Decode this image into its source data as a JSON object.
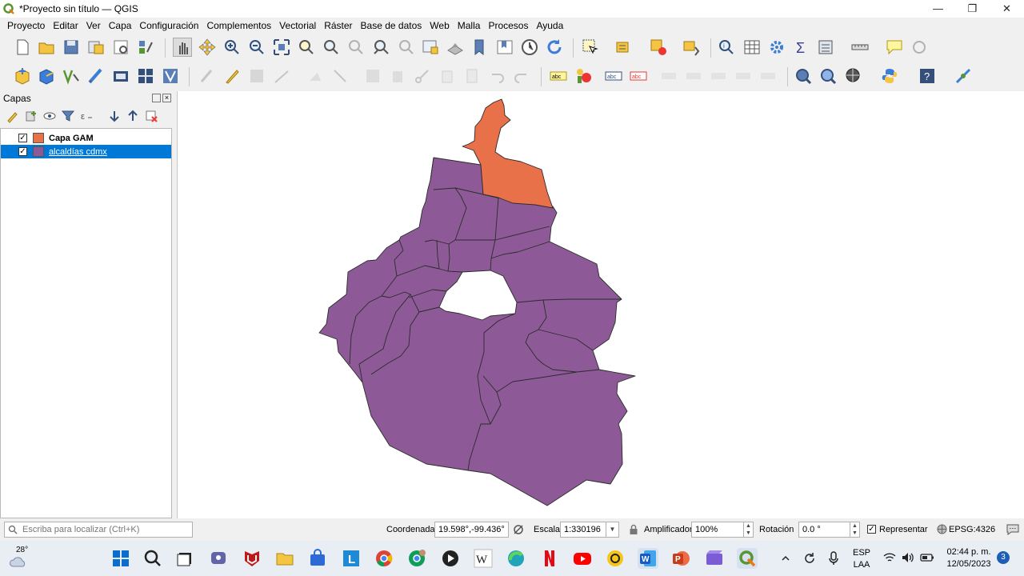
{
  "window": {
    "title": "*Proyecto sin título — QGIS",
    "minimize": "—",
    "maximize": "❐",
    "close": "✕"
  },
  "menu": [
    "Proyecto",
    "Editar",
    "Ver",
    "Capa",
    "Configuración",
    "Complementos",
    "Vectorial",
    "Ráster",
    "Base de datos",
    "Web",
    "Malla",
    "Procesos",
    "Ayuda"
  ],
  "layers_panel": {
    "title": "Capas",
    "layers": [
      {
        "name": "Capa GAM",
        "checked": "✓",
        "color": "#e8714a",
        "selected": false
      },
      {
        "name": "alcaldías cdmx",
        "checked": "✓",
        "color": "#8d5a97",
        "selected": true
      }
    ]
  },
  "map": {
    "fill_main": "#8d5a97",
    "fill_gam": "#e8714a",
    "stroke": "#2b2b2b"
  },
  "status": {
    "locator_placeholder": "Escriba para localizar (Ctrl+K)",
    "coord_label": "Coordenada",
    "coord_value": "19.598°,-99.436°",
    "scale_label": "Escala",
    "scale_value": "1:330196",
    "magnifier_label": "Amplificador",
    "magnifier_value": "100%",
    "rotation_label": "Rotación",
    "rotation_value": "0.0 °",
    "render_label": "Representar",
    "render_checked": "✓",
    "crs": "EPSG:4326"
  },
  "taskbar": {
    "weather_temp": "28°",
    "lang_top": "ESP",
    "lang_bottom": "LAA",
    "time": "02:44 p. m.",
    "date": "12/05/2023",
    "notifications": "3"
  }
}
